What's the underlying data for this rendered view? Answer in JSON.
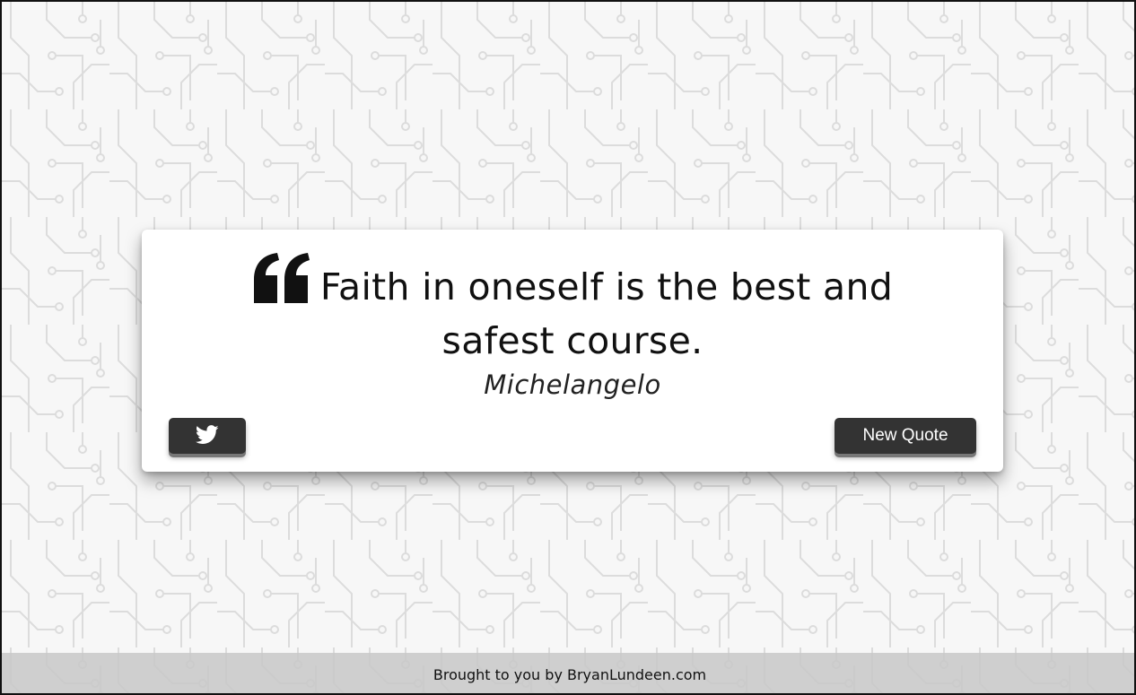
{
  "quote": {
    "text": "Faith in oneself is the best and safest course.",
    "author": "Michelangelo",
    "icon": "quote-left-icon"
  },
  "buttons": {
    "tweet_icon": "twitter-icon",
    "new_quote_label": "New Quote"
  },
  "footer": {
    "credit_text": "Brought to you by BryanLundeen.com"
  },
  "colors": {
    "button_bg": "#333333",
    "card_bg": "#ffffff",
    "footer_bg": "#c8c8c8"
  }
}
